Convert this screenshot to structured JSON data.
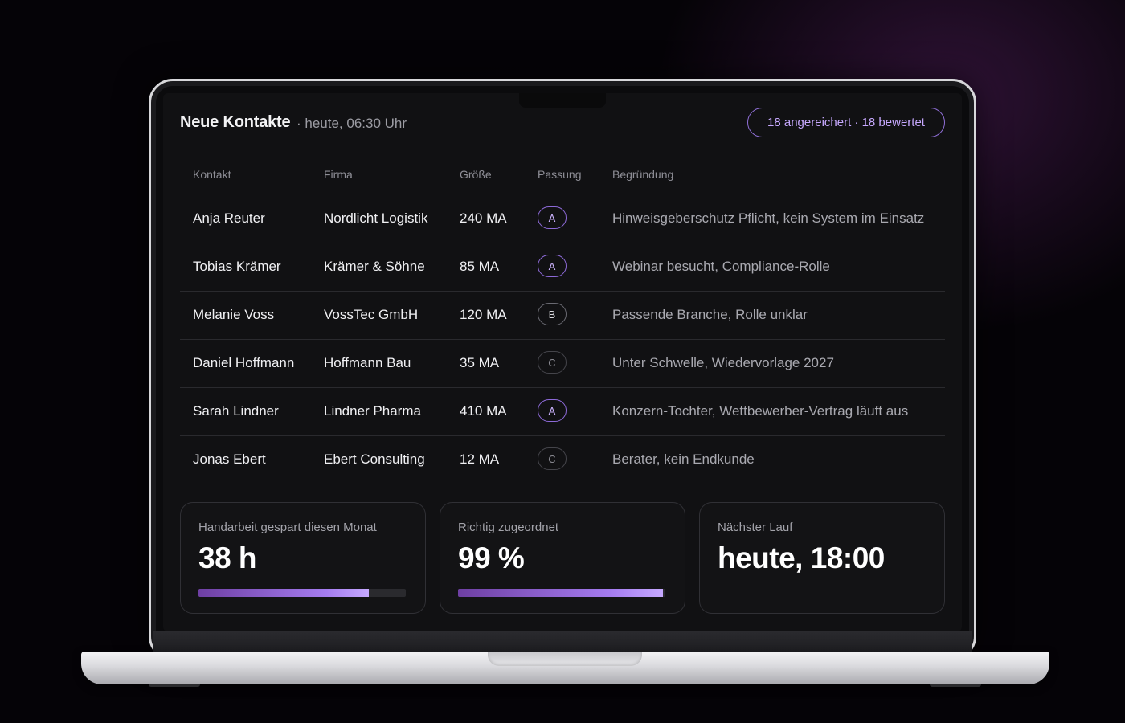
{
  "header": {
    "title": "Neue Kontakte",
    "subtitle": "· heute, 06:30 Uhr",
    "badge": "18 angereichert · 18 bewertet"
  },
  "table": {
    "columns": [
      "Kontakt",
      "Firma",
      "Größe",
      "Passung",
      "Begründung"
    ],
    "rows": [
      {
        "contact": "Anja Reuter",
        "company": "Nordlicht Logistik",
        "size": "240 MA",
        "fit": "A",
        "reason": "Hinweisgeberschutz Pflicht, kein System im Einsatz"
      },
      {
        "contact": "Tobias Krämer",
        "company": "Krämer & Söhne",
        "size": "85 MA",
        "fit": "A",
        "reason": "Webinar besucht, Compliance-Rolle"
      },
      {
        "contact": "Melanie Voss",
        "company": "VossTec GmbH",
        "size": "120 MA",
        "fit": "B",
        "reason": "Passende Branche, Rolle unklar"
      },
      {
        "contact": "Daniel Hoffmann",
        "company": "Hoffmann Bau",
        "size": "35 MA",
        "fit": "C",
        "reason": "Unter Schwelle, Wiedervorlage 2027"
      },
      {
        "contact": "Sarah Lindner",
        "company": "Lindner Pharma",
        "size": "410 MA",
        "fit": "A",
        "reason": "Konzern-Tochter, Wettbewerber-Vertrag läuft aus"
      },
      {
        "contact": "Jonas Ebert",
        "company": "Ebert Consulting",
        "size": "12 MA",
        "fit": "C",
        "reason": "Berater, kein Endkunde"
      }
    ]
  },
  "stats": [
    {
      "label": "Handarbeit gespart diesen Monat",
      "value": "38 h",
      "progress": 0.82
    },
    {
      "label": "Richtig zugeordnet",
      "value": "99 %",
      "progress": 0.99
    },
    {
      "label": "Nächster Lauf",
      "value": "heute, 18:00"
    }
  ],
  "colors": {
    "accent": "#a57cf0",
    "accent_border": "#8f6fd6",
    "background": "#111113"
  }
}
